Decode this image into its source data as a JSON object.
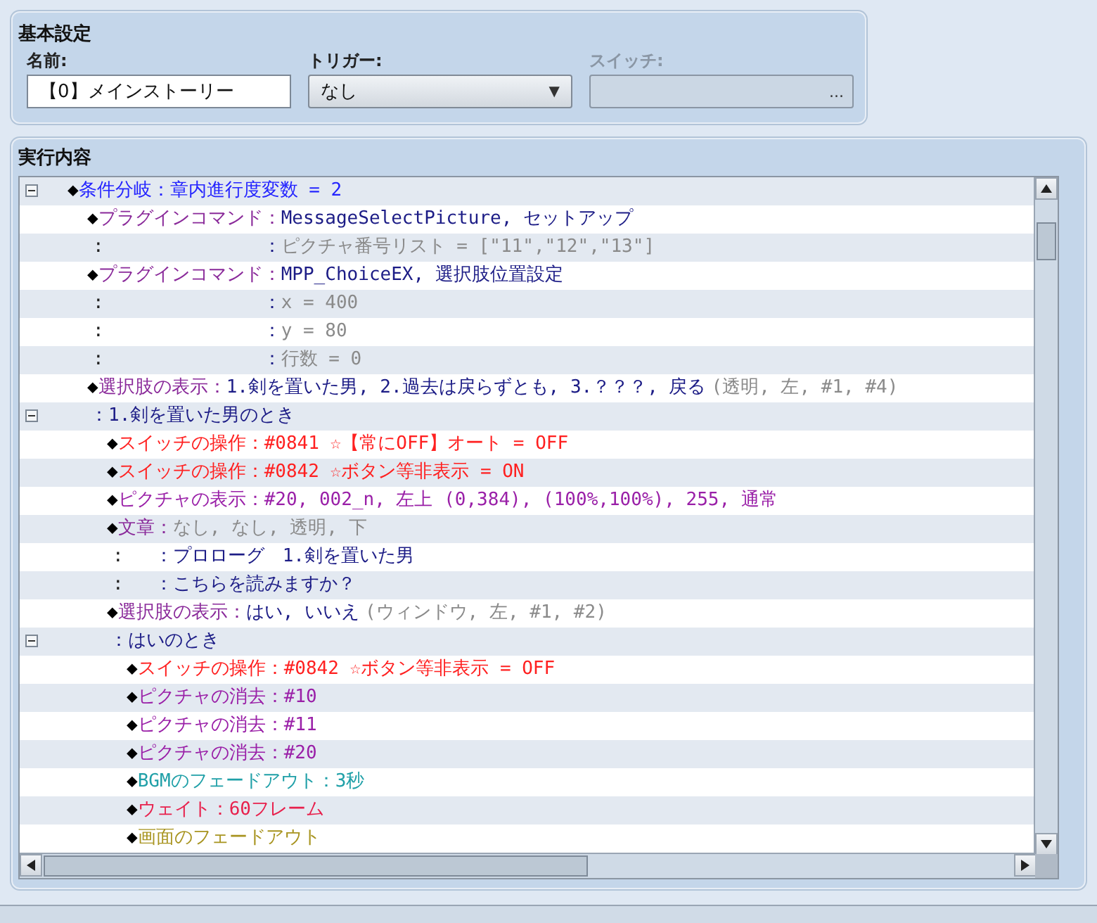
{
  "basic": {
    "title": "基本設定",
    "name": {
      "label": "名前:",
      "value": "【0】メインストーリー"
    },
    "trigger": {
      "label": "トリガー:",
      "value": "なし",
      "arrow": "▼"
    },
    "switch": {
      "label": "スイッチ:",
      "disabled": true,
      "button": "..."
    }
  },
  "contents": {
    "title": "実行内容",
    "rows": [
      {
        "kind": "command",
        "expanded": true,
        "bullet": "◆",
        "head": "条件分岐：",
        "body": "章内進行度変数 = 2",
        "color": "#2424ff",
        "colored": true,
        "muted": false,
        "children": [
          {
            "kind": "command",
            "bullet": "◆",
            "head": "プラグインコマンド：",
            "body": "MessageSelectPicture, セットアップ",
            "color": "#8a2a9a",
            "colored": false,
            "muted": false,
            "lines": [
              {
                "mark": ":",
                "sep": "：",
                "text": "ピクチャ番号リスト = [\"11\",\"12\",\"13\"]",
                "muted": true
              }
            ]
          },
          {
            "kind": "command",
            "bullet": "◆",
            "head": "プラグインコマンド：",
            "body": "MPP_ChoiceEX, 選択肢位置設定",
            "color": "#8a2a9a",
            "colored": false,
            "muted": false,
            "lines": [
              {
                "mark": ":",
                "sep": "：",
                "text": "x = 400",
                "muted": true
              },
              {
                "mark": ":",
                "sep": "：",
                "text": "y = 80",
                "muted": true
              },
              {
                "mark": ":",
                "sep": "：",
                "text": "行数 = 0",
                "muted": true
              }
            ]
          },
          {
            "kind": "command",
            "bullet": "◆",
            "head": "選択肢の表示：",
            "body": "1.剣を置いた男, 2.過去は戻らずとも, 3.？？？, 戻る",
            "note": "(透明, 左, #1, #4)",
            "color": "#8a2a9a",
            "colored": false,
            "muted": false
          },
          {
            "kind": "branch",
            "expanded": true,
            "text": "：1.剣を置いた男のとき",
            "children": [
              {
                "kind": "command",
                "bullet": "◆",
                "head": "スイッチの操作：",
                "body": "#0841 ☆【常にOFF】オート = OFF",
                "color": "#ff2020",
                "colored": true,
                "muted": false
              },
              {
                "kind": "command",
                "bullet": "◆",
                "head": "スイッチの操作：",
                "body": "#0842 ☆ボタン等非表示 = ON",
                "color": "#ff2020",
                "colored": true,
                "muted": false
              },
              {
                "kind": "command",
                "bullet": "◆",
                "head": "ピクチャの表示：",
                "body": "#20, 002_n, 左上 (0,384), (100%,100%), 255, 通常",
                "color": "#9a20a8",
                "colored": true,
                "muted": false
              },
              {
                "kind": "command",
                "bullet": "◆",
                "head": "文章：",
                "body": "なし, なし, 透明, 下",
                "color": "#8a2a9a",
                "muted": true,
                "lines": [
                  {
                    "mark": ":",
                    "sep": "：",
                    "text": "プロローグ　1.剣を置いた男",
                    "muted": false
                  },
                  {
                    "mark": ":",
                    "sep": "：",
                    "text": "こちらを読みますか？",
                    "muted": false
                  }
                ]
              },
              {
                "kind": "command",
                "bullet": "◆",
                "head": "選択肢の表示：",
                "body": "はい, いいえ",
                "note": "(ウィンドウ, 左, #1, #2)",
                "color": "#8a2a9a",
                "colored": false,
                "muted": false
              },
              {
                "kind": "branch",
                "expanded": true,
                "text": "：はいのとき",
                "children": [
                  {
                    "kind": "command",
                    "bullet": "◆",
                    "head": "スイッチの操作：",
                    "body": "#0842 ☆ボタン等非表示 = OFF",
                    "color": "#ff2020",
                    "colored": true,
                    "muted": false
                  },
                  {
                    "kind": "command",
                    "bullet": "◆",
                    "head": "ピクチャの消去：",
                    "body": "#10",
                    "color": "#9a20a8",
                    "colored": true,
                    "muted": false
                  },
                  {
                    "kind": "command",
                    "bullet": "◆",
                    "head": "ピクチャの消去：",
                    "body": "#11",
                    "color": "#9a20a8",
                    "colored": true,
                    "muted": false
                  },
                  {
                    "kind": "command",
                    "bullet": "◆",
                    "head": "ピクチャの消去：",
                    "body": "#20",
                    "color": "#9a20a8",
                    "colored": true,
                    "muted": false
                  },
                  {
                    "kind": "command",
                    "bullet": "◆",
                    "head": "BGMのフェードアウト：",
                    "body": "3秒",
                    "color": "#20a0a8",
                    "colored": true,
                    "muted": false
                  },
                  {
                    "kind": "command",
                    "bullet": "◆",
                    "head": "ウェイト：",
                    "body": "60フレーム",
                    "color": "#e8204c",
                    "colored": true,
                    "muted": false
                  },
                  {
                    "kind": "command",
                    "bullet": "◆",
                    "head": "画面のフェードアウト",
                    "color": "#a89420"
                  }
                ]
              }
            ]
          }
        ]
      }
    ]
  }
}
